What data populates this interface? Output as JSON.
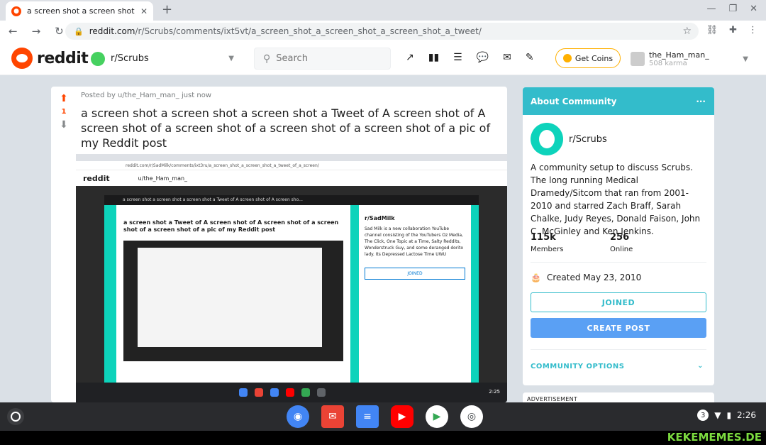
{
  "browser": {
    "tab_title": "a screen shot a screen shot a scr",
    "tab_close": "✕",
    "new_tab": "+",
    "window_controls": [
      "—",
      "❐",
      "✕"
    ],
    "back": "←",
    "forward": "→",
    "reload": "↻",
    "url_host": "reddit.com",
    "url_path": "/r/Scrubs/comments/ixt5vt/a_screen_shot_a_screen_shot_a_screen_shot_a_tweet/",
    "bookmark_icon": "☆",
    "extensions": [
      "⛓",
      "✚",
      "⋮"
    ]
  },
  "header": {
    "logo_text": "reddit",
    "subreddit": "r/Scrubs",
    "search_placeholder": "Search",
    "icons": [
      "↗",
      "▮▮",
      "☰",
      "💬",
      "✉",
      "✎"
    ],
    "coins_label": "Get Coins",
    "username": "the_Ham_man_",
    "karma": "508 karma"
  },
  "post": {
    "vote_count": "1",
    "meta": "Posted by u/the_Ham_man_ just now",
    "title": "a screen shot a screen shot a screen shot a Tweet of A screen shot of A screen shot of a screen shot of a screen shot of a screen shot of a pic of my Reddit post",
    "embed": {
      "url": "reddit.com/r/SadMilk/comments/ixt3ru/a_screen_shot_a_screen_shot_a_tweet_of_a_screen/",
      "header_user": "u/the_Ham_man_",
      "modal_bar": "a screen shot a screen shot a screen shot a Tweet of A screen shot of A screen sho...",
      "title": "a screen shot a Tweet of A screen shot of A screen shot of a screen shot of a screen shot of a pic of my Reddit post",
      "side_name": "r/SadMilk",
      "side_desc": "Sad Milk is a new collaboration YouTube channel consisting of the YouTubers Oz Media, The Click, One Topic at a Time, Salty Reddits, Wonderstruck Guy, and some deranged dorito lady. Its Depressed Lactose Time UWU",
      "side_joined": "JOINED",
      "time": "2:25"
    }
  },
  "sidebar": {
    "heading": "About Community",
    "more": "···",
    "name": "r/Scrubs",
    "description": "A community setup to discuss Scrubs. The long running Medical Dramedy/Sitcom that ran from 2001-2010 and starred Zach Braff, Sarah Chalke, Judy Reyes, Donald Faison, John C. McGinley and Ken Jenkins.",
    "members_count": "115k",
    "members_label": "Members",
    "online_count": "256",
    "online_label": "Online",
    "created": "Created May 23, 2010",
    "joined_label": "JOINED",
    "create_post_label": "CREATE POST",
    "community_options": "COMMUNITY OPTIONS",
    "advertisement": "ADVERTISEMENT"
  },
  "shelf": {
    "apps": [
      {
        "name": "chrome",
        "color": "#4285F4"
      },
      {
        "name": "gmail",
        "color": "#EA4335"
      },
      {
        "name": "docs",
        "color": "#4285F4"
      },
      {
        "name": "youtube",
        "color": "#FF0000"
      },
      {
        "name": "play",
        "color": "#34A853"
      },
      {
        "name": "camera",
        "color": "#3c4043"
      }
    ],
    "notification_count": "3",
    "time": "2:26"
  },
  "watermark": "KEKEMEMES.DE"
}
